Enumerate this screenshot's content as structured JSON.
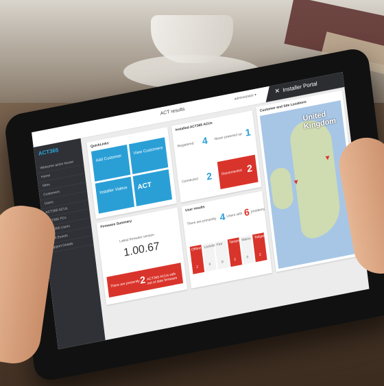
{
  "topbar": {
    "app_title": "ACT results",
    "user_menu": "administrator ▾",
    "portal_label": "Installer Portal",
    "portal_icon": "wrench-cross-icon"
  },
  "sidebar": {
    "logo": "ACT365",
    "items": [
      "Welcome acton house",
      "Home",
      "Sites",
      "Customers",
      "Users",
      "ACT365 ACUs",
      "ACT365 PCs",
      "ACT365 Users",
      "Audit Events",
      "Support Details"
    ]
  },
  "quicklinks": {
    "title": "QuickLinks",
    "tiles": [
      "Add Customer",
      "View Customers",
      "Installer Videos",
      "ACT"
    ]
  },
  "installed_acus": {
    "title": "Installed ACT365 ACUs",
    "registered_label": "Registered",
    "registered_value": "4",
    "never_label": "Never powered up",
    "never_value": "1",
    "connected_label": "Connected",
    "connected_value": "2",
    "disconnected_label": "Disconnected",
    "disconnected_value": "2"
  },
  "firmware": {
    "title": "Firmware Summary",
    "latest_label": "Latest firmware version",
    "version": "1.00.67",
    "alert_prefix": "There are presently",
    "alert_count": "2",
    "alert_suffix": "ACT365 ACUs with out of date firmware"
  },
  "user_results": {
    "title": "User results",
    "text_prefix": "There are presently",
    "a_value": "4",
    "mid": "Users with",
    "b_value": "6",
    "suffix": "problems",
    "stats": [
      {
        "label": "Offline",
        "value": "2"
      },
      {
        "label": "Lockdown",
        "value": "0"
      },
      {
        "label": "Fire",
        "value": "0"
      },
      {
        "label": "Tamper",
        "value": "2"
      },
      {
        "label": "Mains",
        "value": "0"
      },
      {
        "label": "Tailgate",
        "value": "2"
      }
    ]
  },
  "map": {
    "title": "Customer and Site Locations",
    "label": "United Kingdom"
  },
  "colors": {
    "blue": "#2a9fd6",
    "red": "#d9342b",
    "sidebar": "#2f3136"
  }
}
